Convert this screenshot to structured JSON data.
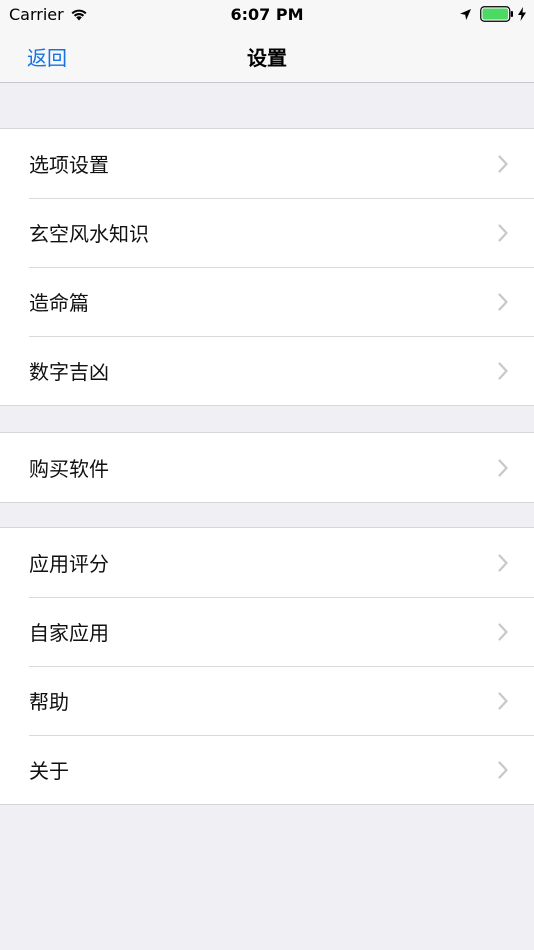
{
  "status_bar": {
    "carrier": "Carrier",
    "time": "6:07 PM",
    "icons": [
      "wifi-icon",
      "location-arrow-icon",
      "battery-icon",
      "charging-bolt-icon"
    ],
    "battery_color": "#4CD964"
  },
  "nav": {
    "back_label": "返回",
    "title": "设置",
    "accent_color": "#1672E5"
  },
  "groups": [
    {
      "items": [
        {
          "label": "选项设置"
        },
        {
          "label": "玄空风水知识"
        },
        {
          "label": "造命篇"
        },
        {
          "label": "数字吉凶"
        }
      ]
    },
    {
      "items": [
        {
          "label": "购买软件"
        }
      ]
    },
    {
      "items": [
        {
          "label": "应用评分"
        },
        {
          "label": "自家应用"
        },
        {
          "label": "帮助"
        },
        {
          "label": "关于"
        }
      ]
    }
  ]
}
